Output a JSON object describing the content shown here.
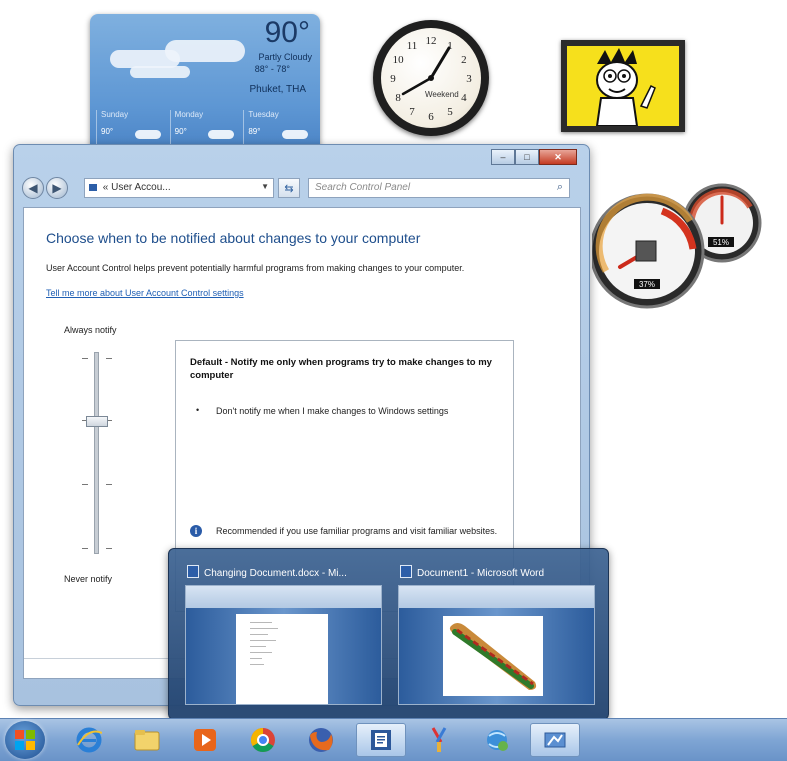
{
  "weather": {
    "temperature": "90°",
    "condition": "Partly Cloudy",
    "range": "88° - 78°",
    "location": "Phuket, THA",
    "days": [
      {
        "name": "Sunday",
        "temp": "90°"
      },
      {
        "name": "Monday",
        "temp": "90°"
      },
      {
        "name": "Tuesday",
        "temp": "89°"
      }
    ]
  },
  "clock": {
    "label": "Weekend",
    "numerals": [
      "12",
      "1",
      "2",
      "3",
      "4",
      "5",
      "6",
      "7",
      "8",
      "9",
      "10",
      "11"
    ]
  },
  "cpu_meter": {
    "cpu_label": "37%",
    "memory_label": "51%",
    "cpu_percent": 37,
    "memory_percent": 51
  },
  "window": {
    "caption_buttons": {
      "minimize": "–",
      "maximize": "□",
      "close": "✕"
    },
    "nav": {
      "back": "◀",
      "forward": "▶"
    },
    "address": "User Accou...",
    "address_prefix": "«",
    "search_placeholder": "Search Control Panel",
    "title": "Choose when to be notified about changes to your computer",
    "description": "User Account Control helps prevent potentially harmful programs from making changes to your computer.",
    "link": "Tell me more about User Account Control settings",
    "slider": {
      "top_label": "Always notify",
      "bottom_label": "Never notify",
      "level_index": 1,
      "levels": 4
    },
    "info": {
      "heading": "Default - Notify me only when programs try to make changes to my computer",
      "bullet": "Don't notify me when I make changes to Windows settings",
      "recommendation": "Recommended if you use familiar programs and visit familiar websites."
    }
  },
  "thumbnails": [
    {
      "title": "Changing Document.docx - Mi..."
    },
    {
      "title": "Document1 - Microsoft Word"
    }
  ],
  "taskbar": {
    "items": [
      "start-orb",
      "internet-explorer-icon",
      "folder-icon",
      "media-player-icon",
      "chrome-icon",
      "firefox-icon",
      "word-icon",
      "paint-icon",
      "network-icon",
      "control-panel-icon"
    ]
  },
  "colors": {
    "title_blue": "#1e4e8c",
    "link_blue": "#1f5fb4",
    "taskbar": "#7fa5d4",
    "picture_yellow": "#f6e01c"
  }
}
